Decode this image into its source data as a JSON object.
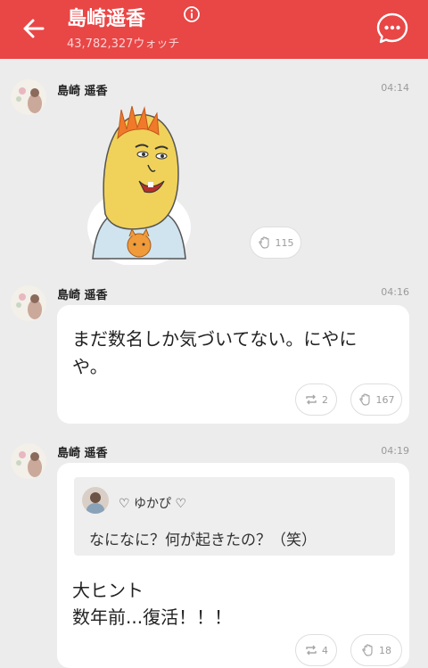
{
  "header": {
    "title": "島崎遥香",
    "watch_count": "43,782,327ウォッチ",
    "back_icon": "arrow-left-icon",
    "info_icon": "info-icon",
    "chat_icon": "chat-bubble-icon",
    "color": "#e94646"
  },
  "posts": [
    {
      "author": "島崎 遥香",
      "time": "04:14",
      "type": "sticker",
      "likes": "115"
    },
    {
      "author": "島崎 遥香",
      "time": "04:16",
      "text_line1": "まだ数名しか気づいてない。にやに",
      "text_line2": "や。",
      "reposts": "2",
      "likes": "167"
    },
    {
      "author": "島崎 遥香",
      "time": "04:19",
      "quote_author": "♡ ゆかぴ ♡",
      "quote_text": "なになに？何が起きたの？（笑）",
      "text_line1": "大ヒント",
      "text_line2": "数年前...復活！！！",
      "reposts": "4",
      "likes": "18"
    }
  ]
}
